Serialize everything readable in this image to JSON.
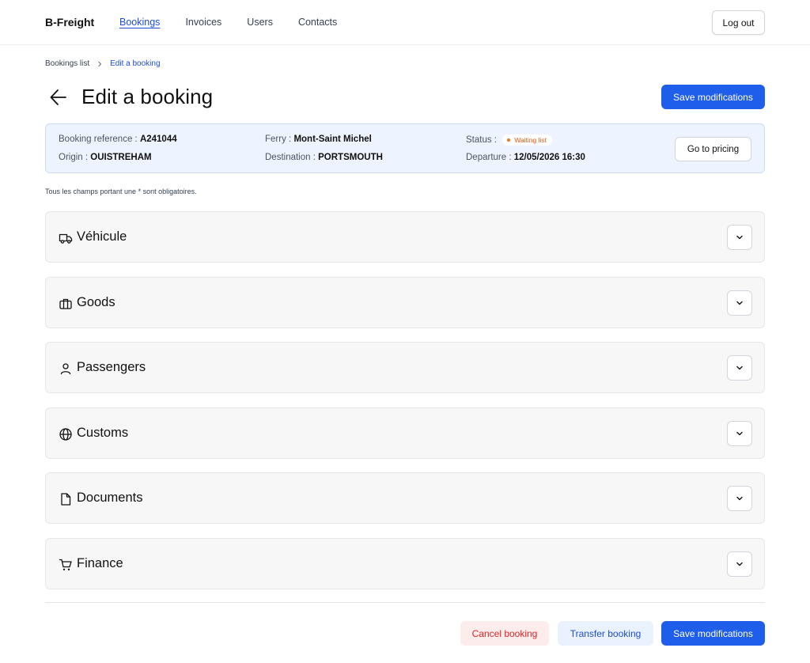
{
  "header": {
    "brand": "B-Freight",
    "nav": [
      "Bookings",
      "Invoices",
      "Users",
      "Contacts"
    ],
    "logout": "Log out"
  },
  "breadcrumb": {
    "parent": "Bookings list",
    "current": "Edit a booking"
  },
  "page": {
    "title": "Edit a booking",
    "save_label": "Save modifications"
  },
  "booking": {
    "reference_label": "Booking reference :",
    "reference": "A241044",
    "origin_label": "Origin :",
    "origin": "OUISTREHAM",
    "ferry_label": "Ferry :",
    "ferry": "Mont-Saint Michel",
    "destination_label": "Destination :",
    "destination": "PORTSMOUTH",
    "status_label": "Status :",
    "status": "Waiting list",
    "departure_label": "Departure :",
    "departure": "12/05/2026 16:30",
    "pricing_button": "Go to pricing"
  },
  "required_note": "Tous les champs portant une * sont obligatoires.",
  "sections": [
    {
      "title": "Véhicule",
      "icon": "truck-icon"
    },
    {
      "title": "Goods",
      "icon": "briefcase-icon"
    },
    {
      "title": "Passengers",
      "icon": "user-icon"
    },
    {
      "title": "Customs",
      "icon": "globe-icon"
    },
    {
      "title": "Documents",
      "icon": "file-icon"
    },
    {
      "title": "Finance",
      "icon": "cart-icon"
    }
  ],
  "footer": {
    "cancel": "Cancel booking",
    "transfer": "Transfer booking",
    "save": "Save modifications"
  },
  "colors": {
    "primary": "#1f5eea",
    "info_bg": "#eef4ff",
    "status": "#ea580c",
    "danger": "#dc2626"
  }
}
